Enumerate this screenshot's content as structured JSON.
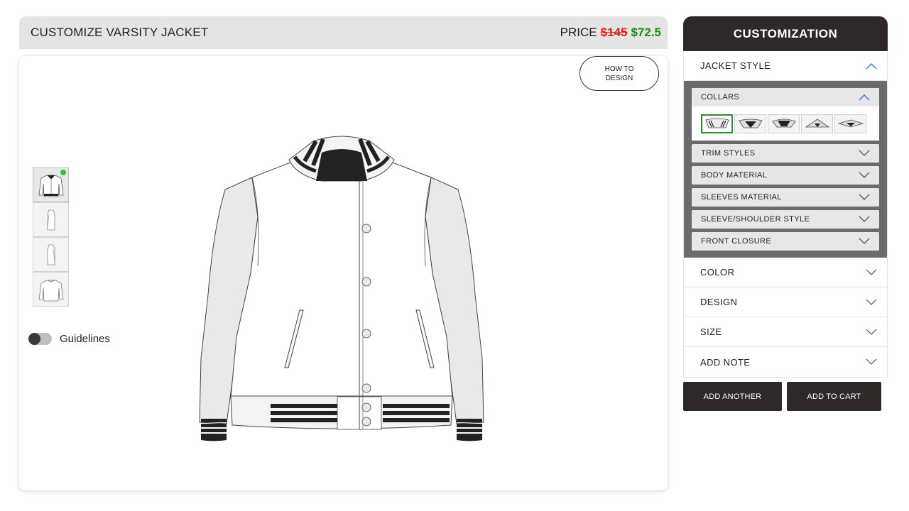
{
  "left": {
    "title": "CUSTOMIZE VARSITY JACKET",
    "price_label": "PRICE",
    "price_old": "$145",
    "price_new": "$72.5",
    "how_to_design": "HOW TO DESIGN",
    "guidelines_label": "Guidelines",
    "guidelines_on": false,
    "views": [
      {
        "name": "front",
        "active": true
      },
      {
        "name": "left-side",
        "active": false
      },
      {
        "name": "right-side",
        "active": false
      },
      {
        "name": "back",
        "active": false
      }
    ]
  },
  "right": {
    "header": "CUSTOMIZATION",
    "jacket_style": "JACKET STYLE",
    "collars": "COLLARS",
    "sub_sections": [
      {
        "label": "TRIM STYLES"
      },
      {
        "label": "BODY MATERIAL"
      },
      {
        "label": "SLEEVES MATERIAL"
      },
      {
        "label": "SLEEVE/SHOULDER STYLE"
      },
      {
        "label": "FRONT CLOSURE"
      }
    ],
    "sections": [
      {
        "label": "COLOR"
      },
      {
        "label": "DESIGN"
      },
      {
        "label": "SIZE"
      },
      {
        "label": "ADD NOTE"
      }
    ],
    "add_another": "ADD ANOTHER",
    "add_to_cart": "ADD TO CART"
  },
  "colors": {
    "accent_dark": "#2e2829",
    "price_old": "#e01f1f",
    "price_new": "#1a8a17",
    "selected_border": "#2f8f2f",
    "chevron_active": "#3a7bd5"
  }
}
